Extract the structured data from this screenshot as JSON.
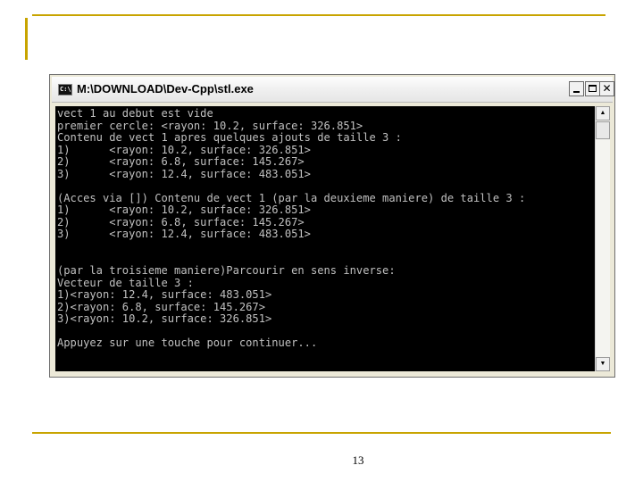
{
  "slide": {
    "page_number": "13"
  },
  "window": {
    "title": "M:\\DOWNLOAD\\Dev-Cpp\\stl.exe",
    "icon": "console-app-icon",
    "icon_text": "C:\\",
    "buttons": {
      "minimize_icon": "minimize-icon",
      "maximize_icon": "maximize-icon",
      "close_label": "✕"
    }
  },
  "console": {
    "lines": [
      "vect 1 au debut est vide",
      "premier cercle: <rayon: 10.2, surface: 326.851>",
      "Contenu de vect 1 apres quelques ajouts de taille 3 :",
      "1)      <rayon: 10.2, surface: 326.851>",
      "2)      <rayon: 6.8, surface: 145.267>",
      "3)      <rayon: 12.4, surface: 483.051>",
      "",
      "(Acces via []) Contenu de vect 1 (par la deuxieme maniere) de taille 3 :",
      "1)      <rayon: 10.2, surface: 326.851>",
      "2)      <rayon: 6.8, surface: 145.267>",
      "3)      <rayon: 12.4, surface: 483.051>",
      "",
      "",
      "(par la troisieme maniere)Parcourir en sens inverse:",
      "Vecteur de taille 3 :",
      "1)<rayon: 12.4, surface: 483.051>",
      "2)<rayon: 6.8, surface: 145.267>",
      "3)<rayon: 10.2, surface: 326.851>",
      "",
      "Appuyez sur une touche pour continuer..."
    ]
  },
  "scrollbar": {
    "up_arrow": "▲",
    "down_arrow": "▼"
  },
  "colors": {
    "accent": "#c8a400",
    "console_bg": "#000000",
    "console_text": "#c0c0c0"
  }
}
